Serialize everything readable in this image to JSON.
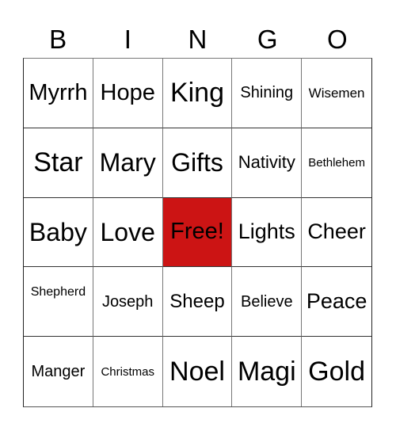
{
  "header": {
    "letters": [
      "B",
      "I",
      "N",
      "G",
      "O"
    ]
  },
  "board": {
    "free_color": "#cc1414",
    "rows": [
      [
        "Myrrh",
        "Hope",
        "King",
        "Shining",
        "Wisemen"
      ],
      [
        "Star",
        "Mary",
        "Gifts",
        "Nativity",
        "Bethlehem"
      ],
      [
        "Baby",
        "Love",
        "Free!",
        "Lights",
        "Cheer"
      ],
      [
        "Shepherd",
        "Joseph",
        "Sheep",
        "Believe",
        "Peace"
      ],
      [
        "Manger",
        "Christmas",
        "Noel",
        "Magi",
        "Gold"
      ]
    ]
  }
}
